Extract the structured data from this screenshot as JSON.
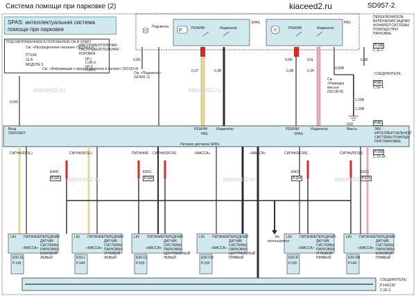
{
  "header": {
    "title": "Система помощи при парковке (2)",
    "site": "kiaceed2.ru",
    "code": "SD957-2"
  },
  "watermark": "kiaceed2.ru",
  "info_box": {
    "line1": "SPAS: интеллектуальная система",
    "line2": "помощи при парковке"
  },
  "power_box": {
    "title": "ПОД НАПРЯЖЕНИЕМ В ПОЛОЖЕНИИ ON И START",
    "ref1": "См. «Распределение питания» (SD110-12)",
    "fuse_name": "ПТ13А",
    "fuse_value": "10 А",
    "module": "МОДУЛЬ 3",
    "ref2": "См. «Информация о предохранителях в салоне» (SD120-4)",
    "junction": "ИНСТРУМЕНТАЛЬНАЯ РАСПРЕДЕЛИТЕЛЬНАЯ КОРОБКА",
    "conn_i": "I/P-I",
    "conn_i_ref": "C.80-3",
    "conn_c": "I/P-C",
    "conn_c_ref": "C.80-5"
  },
  "switch_box": {
    "light_label": "Подсветка",
    "mode1": "РЕЖИМ",
    "indicator1": "Индикатор",
    "spas": "SPAS",
    "mode2": "РЕЖИМ",
    "indicator2": "Индикатор",
    "pas": "PAS"
  },
  "right_notes": {
    "switch_title": "ПЕРЕКЛЮЧАТЕЛЬ ВКЛЮЧЕНИЯ ЗАДНИХ ФОНАРЕЙ СИСТЕМЫ ПОМОЩИ ПРИ ПАРКОВКЕ",
    "ref_m": "M",
    "ref_m_val": "P.158",
    "ref_c": "C.11-2",
    "connector_title": "СОЕДИНИТЕЛЬ",
    "conn_e": "P.95",
    "conn_e2": "C.92-4",
    "ground_ref": "G02",
    "ground_p": "P.96",
    "unit_title": "ЭБУ ИНТЕЛЛЕКТУАЛЬНОЙ СИСТЕМЫ ПОМОЩИ ПРИ ПАРКОВКЕ",
    "unit_ref": "P.159",
    "unit_ref2": "C.10-34",
    "bottom_title": "СОЕДИНИТЕЛЬ",
    "bottom_ref1": "P.146/130",
    "bottom_ref2": "C.92-3"
  },
  "left_refs": {
    "light_ref": "См. «Подсветка» (SD941-1)",
    "light_dash": "См. «Разводка массы» (SD130-8)"
  },
  "wires_top": {
    "w1": "0,5R",
    "w2": "0,3Y",
    "w3": "0,3B",
    "w4": "0,5R",
    "w5": "0,5L",
    "w6": "0,3Р",
    "w7": "0,3B",
    "w8": "0,5B",
    "w9": "0,85B",
    "w10": "1,25B",
    "w11": "1,25B",
    "w12": "0,5W"
  },
  "ecu": {
    "top_left": "Вход ON/START",
    "mode1": "РЕЖИМ",
    "pas": "PAS",
    "indicator1": "Индикатор",
    "mode2": "РЕЖИМ",
    "spas": "SPAS",
    "indicator2": "Индикатор",
    "mass": "Масса",
    "sensor_power": "Питание датчиков SPAS"
  },
  "signals": {
    "s1": "СИГНАЛ(FSL)",
    "s2": "ПИТАНИЕ",
    "s3": "СИГНАЛ(FSL)",
    "s4": "СИГНАЛ(FCR)",
    "s5": "«МАССА»",
    "s6": "«МАССА»",
    "s7": "СИГНАЛ(FSR)",
    "s8": "СИГНАЛ(FSR)"
  },
  "modules": {
    "lin": "LIN",
    "power": "ПИТАНИЕ",
    "mass": "«МАССА»",
    "front_sensor_left": "ПЕРЕДНИЙ ДАТЧИК СИСТЕМЫ ПАРКОВКИ БОКОВОЙ ЛЕВЫЙ",
    "front_sensor_corner_left": "ПЕРЕДНИЙ ДАТЧИК СИСТЕМЫ ПАРКОВКИ УГЛОВОЙ ЛЕВЫЙ",
    "front_sensor_center_left": "ПЕРЕДНИЙ ДАТЧИК СИСТЕМЫ ПАРКОВКИ ЦЕНТРАЛЬНЫЙ ЛЕВЫЙ",
    "front_sensor_center_right": "ПЕРЕДНИЙ ДАТЧИК СИСТЕМЫ ПАРКОВКИ ЦЕНТРАЛЬНЫЙ ПРАВЫЙ",
    "front_sensor_corner_right": "ПЕРЕДНИЙ ДАТЧИК СИСТЕМЫ ПАРКОВКИ УГЛОВОЙ ПРАВЫЙ",
    "front_sensor_right": "ПЕРЕДНИЙ ДАТЧИК СИСТЕМЫ ПАРКОВКИ БОКОВОЙ ПРАВЫЙ",
    "not_used": "Не используется"
  },
  "module_ids": [
    "E50-SL",
    "E50-L",
    "E50-CL",
    "E50-CR",
    "E50-R",
    "E50-SR"
  ],
  "module_refs": [
    "P.149",
    "P.149",
    "P.150",
    "P.150",
    "P.150",
    "P.149"
  ],
  "mid_refs": [
    "EM41",
    "EM11",
    "EM11",
    "EE21"
  ],
  "mid_ref_pages": [
    "P.115",
    "P.114",
    "P.114",
    "P.115"
  ],
  "colors": {
    "info_bg": "#cfe9ee",
    "red_wire": "#e0261e",
    "yellow_wire": "#e3d89a",
    "pink_wire": "#f0a8c0",
    "dark_wire": "#2a2a3a",
    "ecu_bg": "#cfe9ee"
  }
}
